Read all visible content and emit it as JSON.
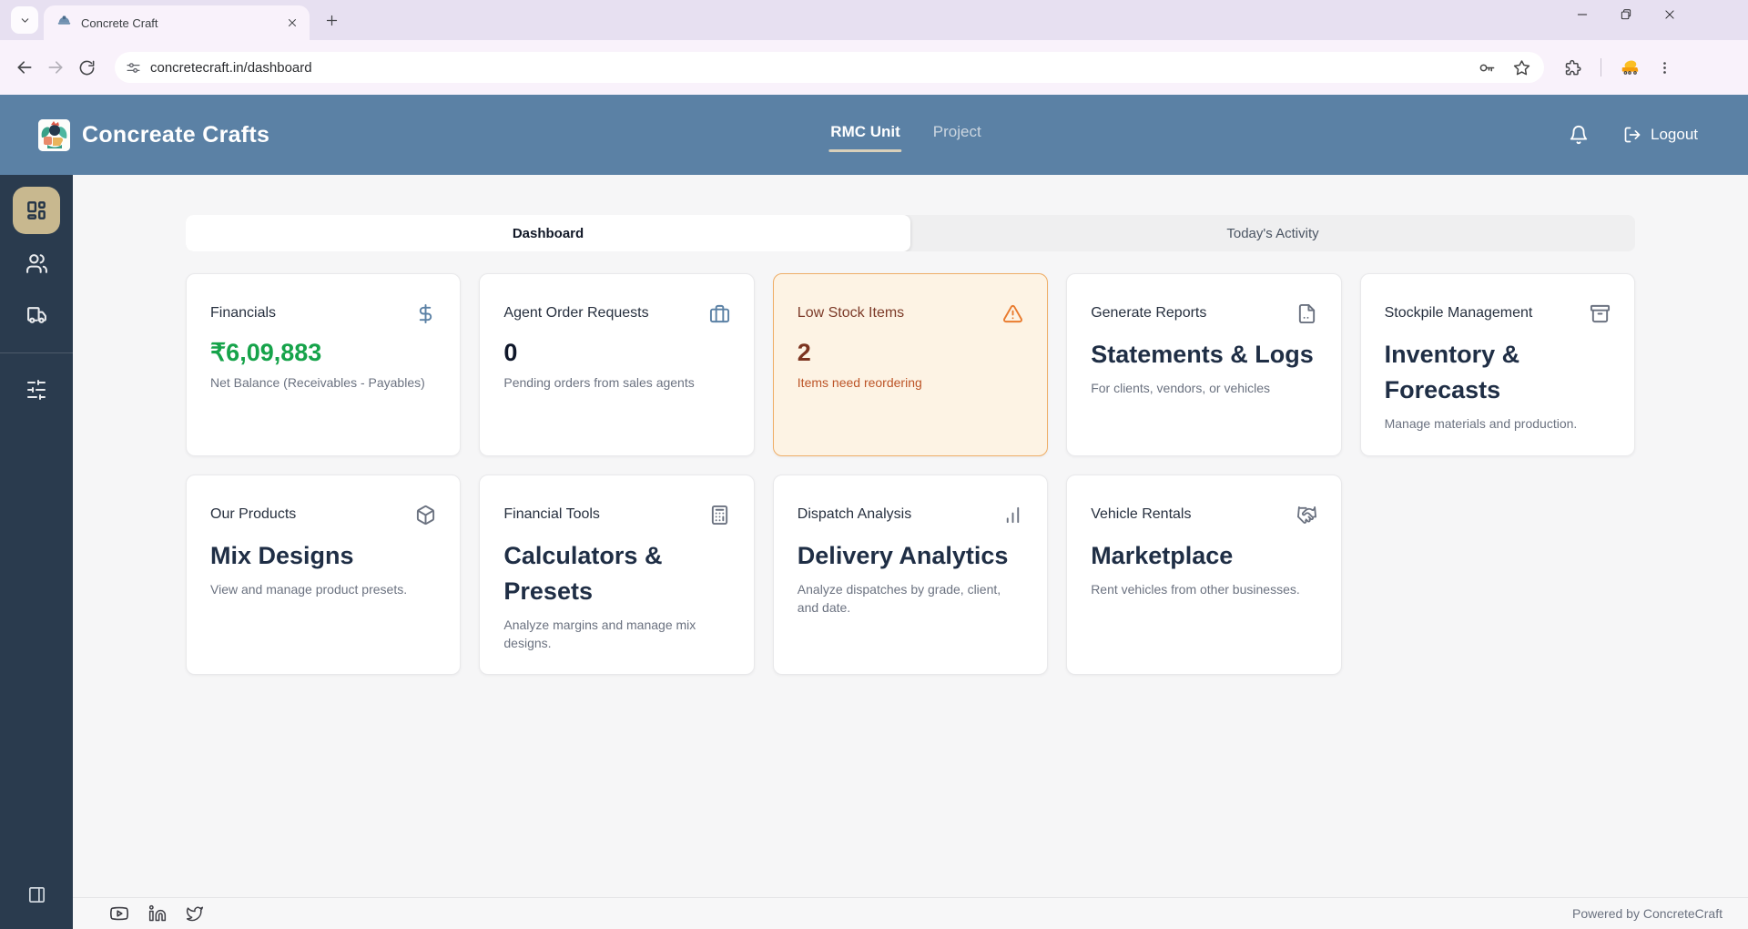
{
  "browser": {
    "tab_title": "Concrete Craft",
    "url": "concretecraft.in/dashboard"
  },
  "header": {
    "brand": "Concreate Crafts",
    "nav": [
      {
        "label": "RMC Unit",
        "active": true
      },
      {
        "label": "Project",
        "active": false
      }
    ],
    "logout_label": "Logout"
  },
  "view_tabs": {
    "dashboard": "Dashboard",
    "activity": "Today's Activity"
  },
  "cards": [
    {
      "title": "Financials",
      "icon": "dollar-sign",
      "value": "₹6,09,883",
      "desc": "Net Balance (Receivables - Payables)"
    },
    {
      "title": "Agent Order Requests",
      "icon": "briefcase",
      "value": "0",
      "desc": "Pending orders from sales agents"
    },
    {
      "title": "Low Stock Items",
      "icon": "alert-triangle",
      "value": "2",
      "desc": "Items need reordering",
      "variant": "warning"
    },
    {
      "title": "Generate Reports",
      "icon": "file-report",
      "heading": "Statements & Logs",
      "desc": "For clients, vendors, or vehicles"
    },
    {
      "title": "Stockpile Management",
      "icon": "archive-box",
      "heading": "Inventory & Forecasts",
      "desc": "Manage materials and production."
    },
    {
      "title": "Our Products",
      "icon": "package",
      "heading": "Mix Designs",
      "desc": "View and manage product presets."
    },
    {
      "title": "Financial Tools",
      "icon": "calculator",
      "heading": "Calculators & Presets",
      "desc": "Analyze margins and manage mix designs."
    },
    {
      "title": "Dispatch Analysis",
      "icon": "bar-chart",
      "heading": "Delivery Analytics",
      "desc": "Analyze dispatches by grade, client, and date."
    },
    {
      "title": "Vehicle Rentals",
      "icon": "handshake",
      "heading": "Marketplace",
      "desc": "Rent vehicles from other businesses."
    }
  ],
  "footer": {
    "powered_by": "Powered by ConcreteCraft",
    "social": [
      "youtube",
      "linkedin",
      "twitter"
    ]
  },
  "colors": {
    "header_bg": "#5b81a5",
    "sidebar_bg": "#2a3b4e",
    "sidebar_active_bg": "#c8b88f",
    "value_green": "#16a34a",
    "warning_bg": "#fdf3e4",
    "warning_border": "#efae67",
    "warning_text": "#7c3a28",
    "warning_desc": "#bc5427",
    "heading_navy": "#1f2e45",
    "card_icon_accent": "#5b81a5",
    "browser_theme": "#e7e0f1"
  }
}
